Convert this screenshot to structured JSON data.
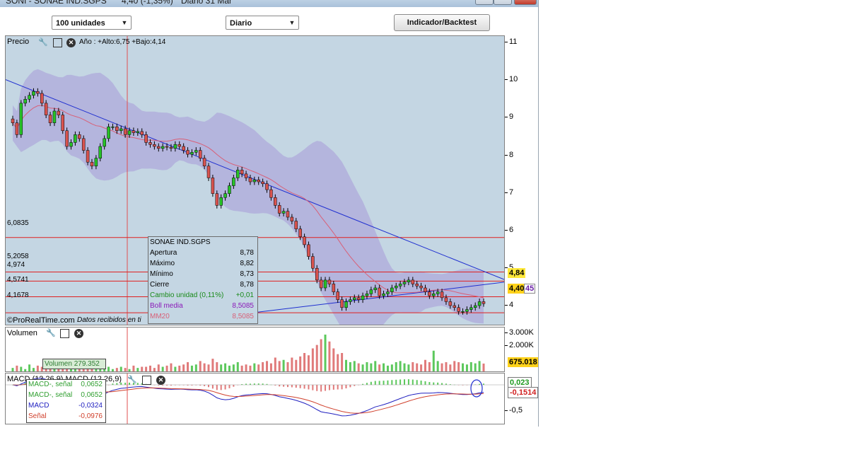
{
  "window": {
    "title": "SONI - SONAE IND.SGPS",
    "title_price": "4,40 (-1,35%)",
    "title_period": "Diario  31 Mar"
  },
  "toolbar": {
    "units_select": "100 unidades",
    "period_select": "Diario",
    "indicator_button": "Indicador/Backtest"
  },
  "price_panel": {
    "label": "Precio",
    "year_range": "Año : +Alto:6,75 +Bajo:4,14",
    "levels": [
      {
        "label": "6,0835",
        "value": 6.0835
      },
      {
        "label": "5,2058",
        "value": 5.2058
      },
      {
        "label": "4,974",
        "value": 4.974
      },
      {
        "label": "4,5741",
        "value": 4.5741
      },
      {
        "label": "4,1678",
        "value": 4.1678
      }
    ],
    "last_close_badge": "4,40",
    "upper_badge": "4,84",
    "overlap_badge": "45",
    "credit": "©ProRealTime.com",
    "credit_note": "Datos recibidos en ti",
    "colors": {
      "up": "#27c227",
      "down": "#d9534f",
      "band": "#a89ad8",
      "trend": "#1f2fd0",
      "ma": "#d86078",
      "level": "#e02020"
    }
  },
  "infobox": {
    "title": "SONAE IND.SGPS",
    "rows": [
      {
        "k": "Apertura",
        "v": "8,78",
        "color": "#000000"
      },
      {
        "k": "Máximo",
        "v": "8,82",
        "color": "#000000"
      },
      {
        "k": "Mínimo",
        "v": "8,73",
        "color": "#000000"
      },
      {
        "k": "Cierre",
        "v": "8,78",
        "color": "#000000"
      },
      {
        "k": "Cambio unidad (0,11%)",
        "v": "+0,01",
        "color": "#1a8a1a"
      },
      {
        "k": "Boll media",
        "v": "8,5085",
        "color": "#8a18b8"
      },
      {
        "k": "MM20",
        "v": "8,5085",
        "color": "#d86078"
      }
    ]
  },
  "volume_panel": {
    "label": "Volumen",
    "tooltip": "Volumen 279.352",
    "ticks": [
      "3.000K",
      "2.000K"
    ],
    "last_badge": "675.018"
  },
  "macd_panel": {
    "label": "MACD (12,26,9) MACD (12,26,9)",
    "ticks": [
      "-0,5"
    ],
    "badge_green": "0,023",
    "badge_red": "-0,1514",
    "rows": [
      {
        "k": "MACD-, señal",
        "v": "0,0652",
        "color": "#2e9e2e"
      },
      {
        "k": "MACD-, señal",
        "v": "0,0652",
        "color": "#2e9e2e"
      },
      {
        "k": "MACD",
        "v": "-0,0324",
        "color": "#2020c0"
      },
      {
        "k": "Señal",
        "v": "-0,0976",
        "color": "#d0402c"
      }
    ]
  },
  "chart_data": {
    "type": "candlestick",
    "title": "SONI - SONAE IND.SGPS",
    "ylim": [
      3.9,
      11.1
    ],
    "yticks": [
      4,
      5,
      6,
      7,
      8,
      9,
      10,
      11
    ],
    "closes": [
      9.0,
      8.7,
      9.5,
      9.6,
      9.7,
      9.8,
      9.75,
      9.5,
      9.2,
      9.0,
      9.3,
      9.2,
      8.8,
      8.4,
      8.5,
      8.7,
      8.6,
      8.3,
      8.0,
      7.9,
      8.1,
      8.4,
      8.6,
      8.9,
      8.9,
      8.8,
      8.85,
      8.7,
      8.8,
      8.75,
      8.78,
      8.7,
      8.5,
      8.45,
      8.4,
      8.35,
      8.4,
      8.38,
      8.35,
      8.45,
      8.4,
      8.3,
      8.2,
      8.25,
      8.3,
      8.1,
      7.9,
      7.6,
      7.2,
      6.9,
      7.1,
      7.2,
      7.4,
      7.6,
      7.8,
      7.7,
      7.6,
      7.5,
      7.55,
      7.5,
      7.45,
      7.3,
      7.1,
      6.9,
      6.7,
      6.75,
      6.6,
      6.5,
      6.3,
      6.1,
      5.9,
      5.6,
      5.3,
      5.0,
      4.8,
      5.0,
      4.9,
      4.7,
      4.5,
      4.3,
      4.45,
      4.5,
      4.55,
      4.5,
      4.6,
      4.65,
      4.75,
      4.8,
      4.6,
      4.65,
      4.7,
      4.8,
      4.85,
      4.9,
      4.95,
      5.0,
      4.9,
      4.85,
      4.8,
      4.7,
      4.6,
      4.65,
      4.7,
      4.55,
      4.45,
      4.35,
      4.3,
      4.2,
      4.2,
      4.25,
      4.3,
      4.35,
      4.45,
      4.4
    ],
    "volume_m": [
      0.3,
      0.5,
      0.4,
      0.2,
      0.6,
      0.3,
      0.5,
      0.4,
      0.3,
      0.2,
      0.5,
      0.3,
      0.9,
      0.4,
      0.3,
      0.7,
      0.4,
      0.3,
      0.6,
      0.5,
      0.4,
      0.5,
      0.3,
      0.4,
      0.2,
      0.3,
      0.4,
      0.3,
      0.2,
      0.5,
      0.3,
      0.4,
      0.4,
      0.5,
      0.3,
      0.6,
      0.4,
      0.5,
      0.7,
      0.4,
      0.5,
      0.6,
      0.8,
      0.5,
      0.6,
      0.9,
      0.7,
      0.6,
      1.1,
      0.8,
      0.6,
      0.7,
      0.5,
      0.6,
      0.8,
      0.5,
      0.6,
      0.5,
      0.7,
      0.6,
      0.8,
      0.9,
      0.7,
      1.2,
      0.9,
      1.0,
      0.8,
      1.2,
      1.0,
      1.3,
      1.6,
      1.4,
      2.0,
      2.3,
      2.8,
      3.2,
      2.6,
      2.0,
      1.5,
      1.6,
      1.0,
      0.8,
      0.9,
      0.7,
      0.6,
      0.8,
      0.7,
      0.9,
      0.6,
      0.7,
      0.5,
      0.6,
      0.8,
      0.9,
      0.7,
      0.6,
      0.8,
      0.7,
      0.6,
      1.0,
      0.8,
      1.8,
      0.9,
      0.7,
      0.8,
      0.6,
      0.9,
      0.8,
      0.7,
      0.6,
      0.8,
      0.7,
      0.9,
      0.68
    ],
    "macd_note": "MACD and signal lines bottom near -0.9 mid-period then recover above 0"
  }
}
